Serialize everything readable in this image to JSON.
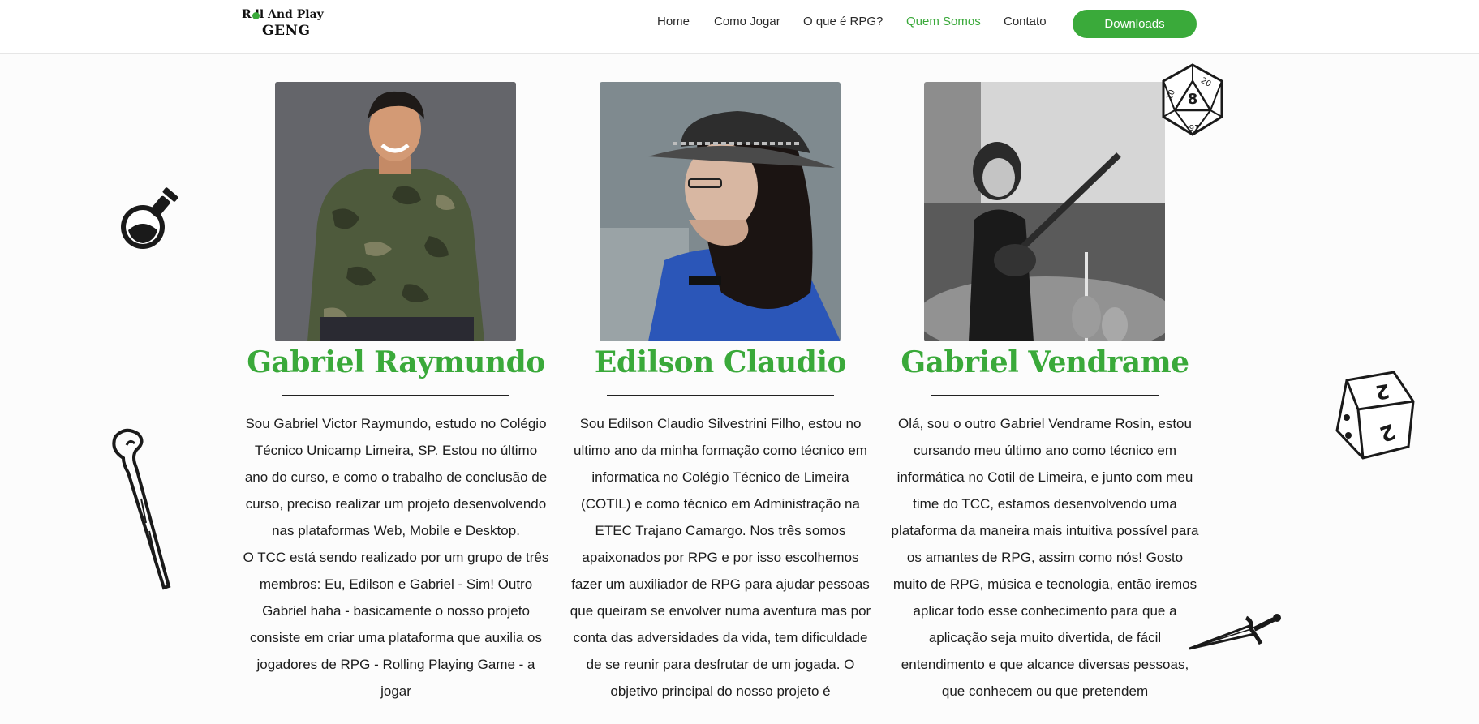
{
  "nav": {
    "logo_line1": "R  ll And Play",
    "logo_line2": "GENG",
    "links": [
      {
        "label": "Home"
      },
      {
        "label": "Como Jogar"
      },
      {
        "label": "O que é RPG?"
      },
      {
        "label": "Quem Somos"
      },
      {
        "label": "Contato"
      }
    ],
    "downloads_label": "Downloads",
    "active_link": "Quem Somos"
  },
  "colors": {
    "accent": "#3aa93a",
    "text": "#1c1c1c",
    "background": "#fcfcfc"
  },
  "members": [
    {
      "name": "Gabriel Raymundo",
      "photo": "portrait-camo-shirt",
      "bio": [
        "Sou Gabriel Victor Raymundo, estudo no Colégio Técnico Unicamp Limeira, SP. Estou no último ano do curso, e como o trabalho de conclusão de curso, preciso realizar um projeto desenvolvendo nas plataformas Web, Mobile e Desktop.",
        "O TCC está sendo realizado por um grupo de três membros: Eu, Edilson e Gabriel - Sim! Outro Gabriel haha - basicamente o nosso projeto consiste em criar uma plataforma que auxilia os jogadores de RPG - Rolling Playing Game - a jogar"
      ]
    },
    {
      "name": "Edilson Claudio",
      "photo": "portrait-hat-long-hair",
      "bio": [
        "Sou Edilson Claudio Silvestrini Filho, estou no ultimo ano da minha formação como técnico em informatica no Colégio Técnico de Limeira (COTIL) e como técnico em Administração na ETEC Trajano Camargo. Nos três somos apaixonados por RPG e por isso escolhemos fazer um auxiliador de RPG para ajudar pessoas que queiram se envolver numa aventura mas por conta das adversidades da vida, tem dificuldade de se reunir para desfrutar de um jogada. O objetivo principal do nosso projeto é"
      ]
    },
    {
      "name": "Gabriel Vendrame",
      "photo": "portrait-guitar-bw",
      "bio": [
        "Olá, sou o outro Gabriel Vendrame Rosin, estou cursando meu último ano como técnico em informática no Cotil de Limeira, e junto com meu time do TCC, estamos desenvolvendo uma plataforma da maneira mais intuitiva possível para os amantes de RPG, assim como nós! Gosto muito de RPG, música e tecnologia, então iremos aplicar todo esse conhecimento para que a aplicação seja muito divertida, de fácil entendimento e que alcance diversas pessoas, que conhecem ou que pretendem"
      ]
    }
  ],
  "decorations": {
    "potion": "potion-icon",
    "staff": "staff-icon",
    "d20": "d20-dice-icon",
    "d6": "d6-dice-icon",
    "dagger": "dagger-icon",
    "d20_faces": [
      "20",
      "8",
      "10",
      "16"
    ],
    "d6_faces": [
      "2",
      "2"
    ]
  }
}
